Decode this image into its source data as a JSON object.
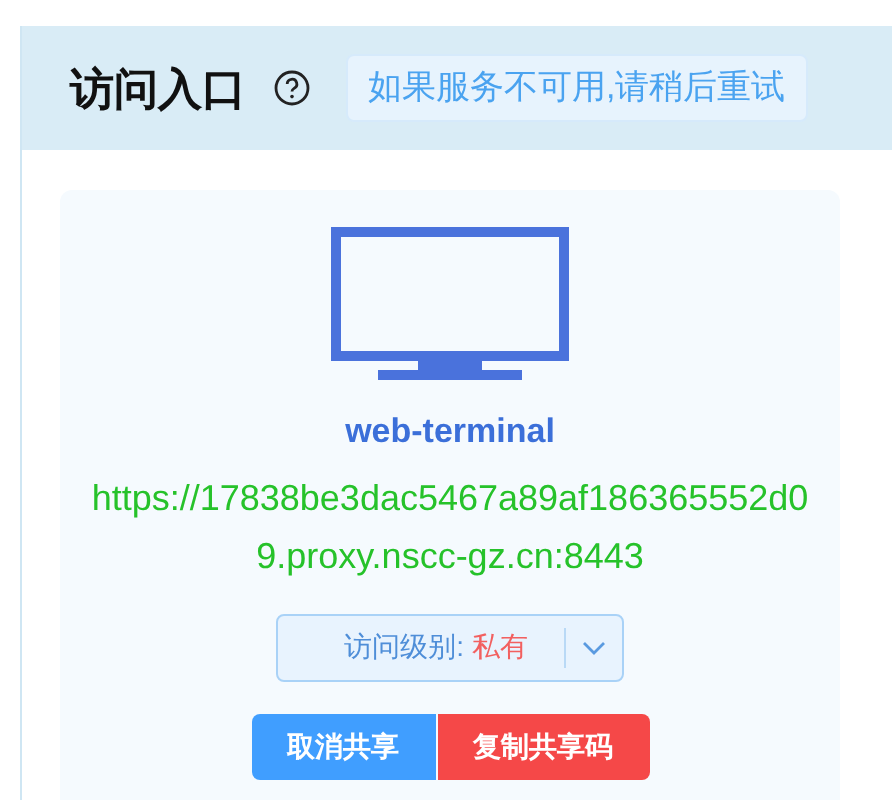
{
  "header": {
    "title": "访问入口",
    "notice": "如果服务不可用,请稍后重试"
  },
  "entry": {
    "name": "web-terminal",
    "url": "https://17838be3dac5467a89af186365552d09.proxy.nscc-gz.cn:8443",
    "access": {
      "label": "访问级别:",
      "value": "私有"
    },
    "buttons": [
      {
        "label": "取消共享",
        "kind": "primary"
      },
      {
        "label": "复制共享码",
        "kind": "danger"
      }
    ]
  }
}
